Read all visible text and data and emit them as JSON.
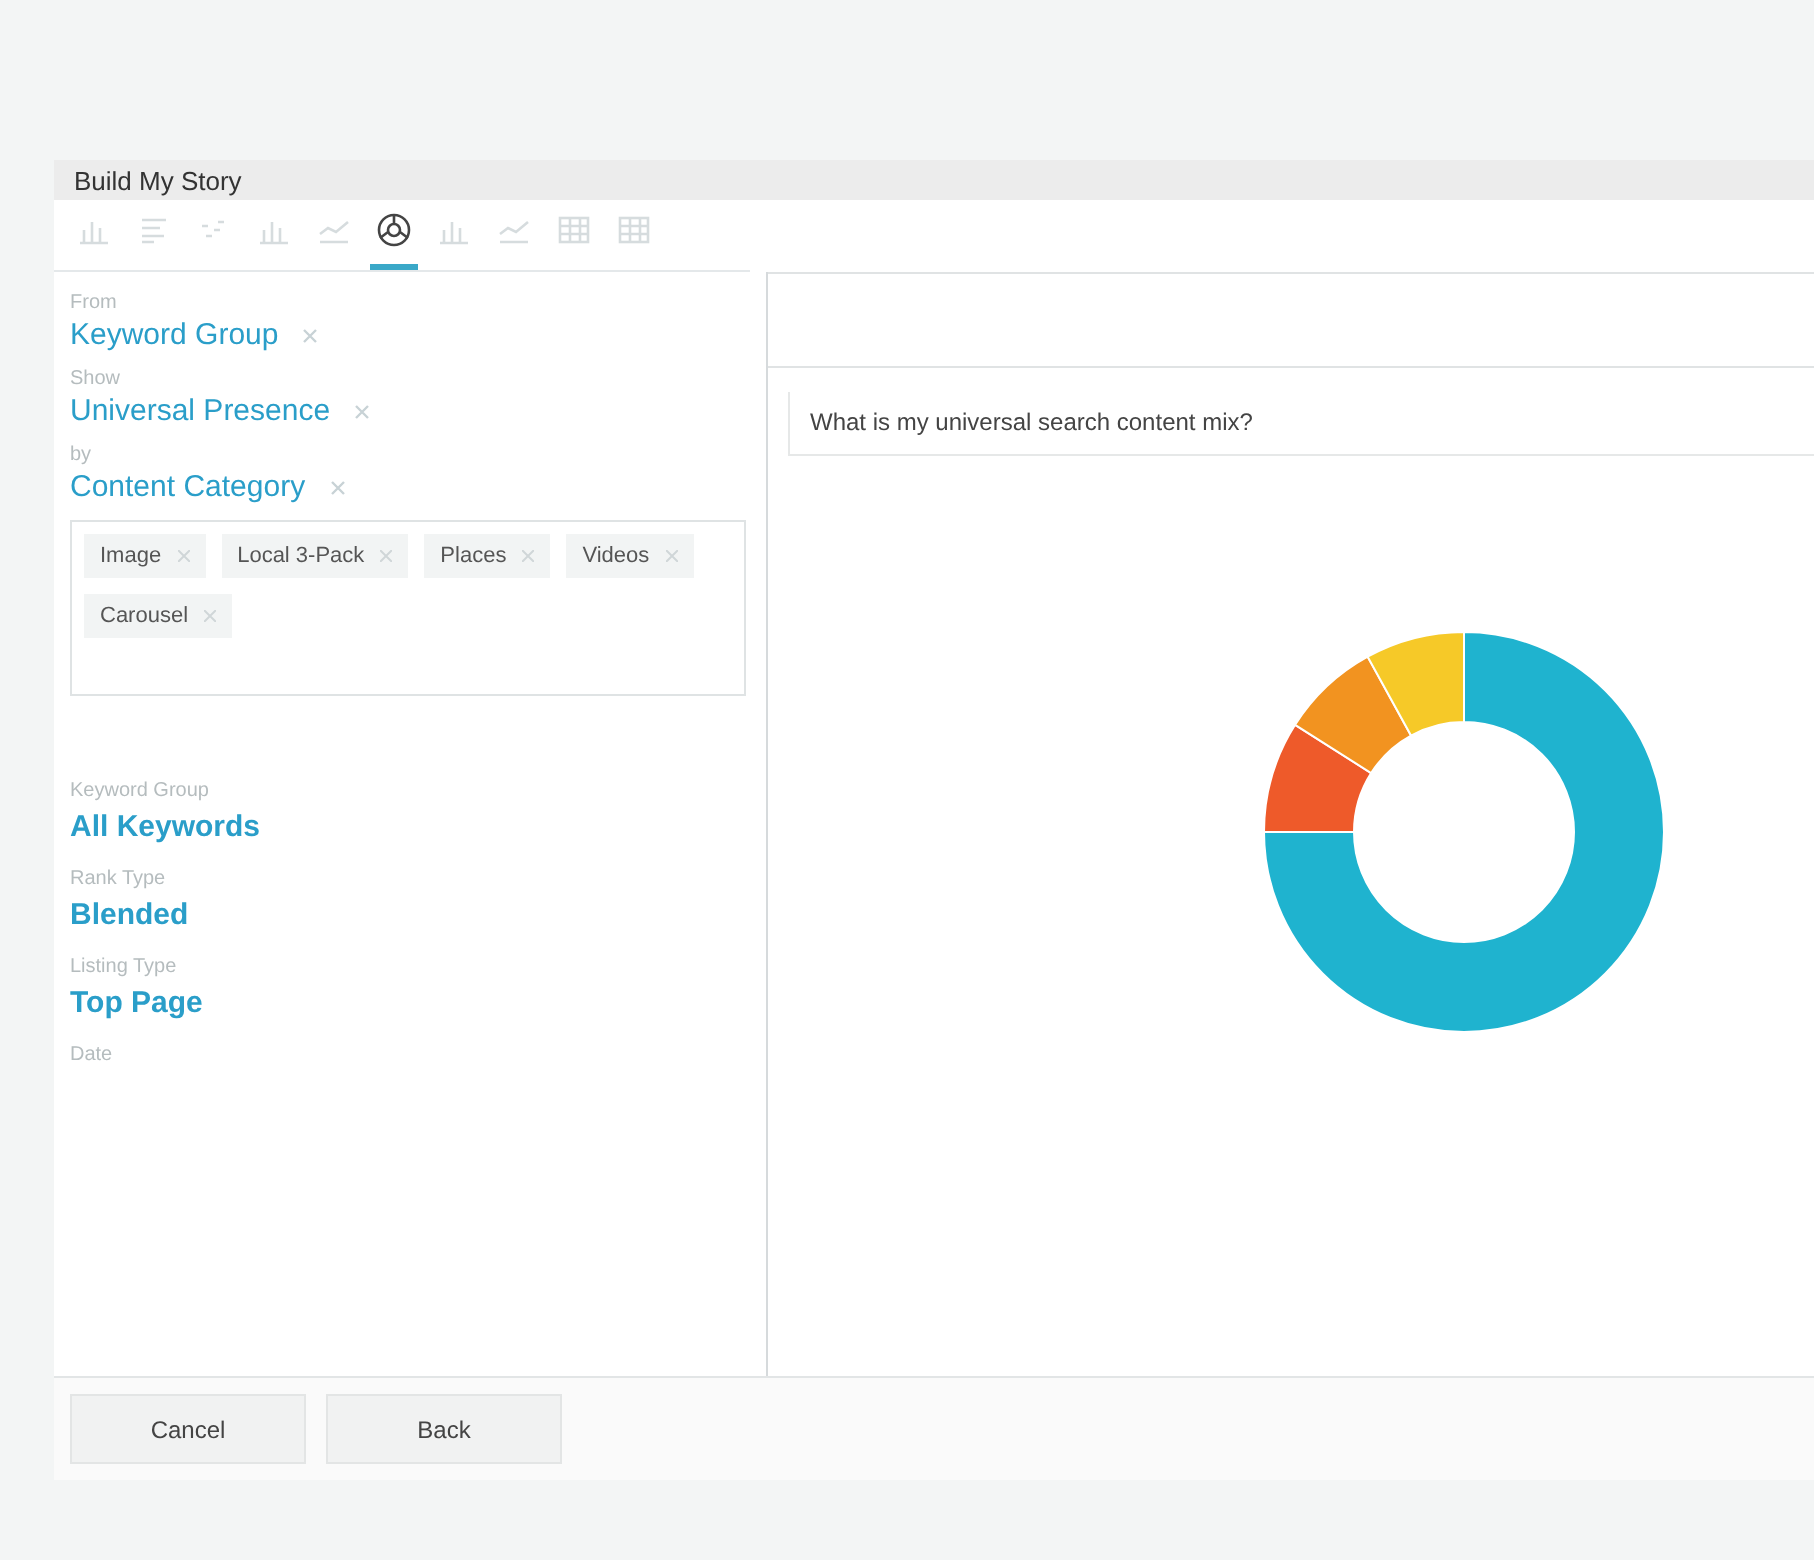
{
  "window": {
    "title": "Build My Story"
  },
  "chart_types": [
    {
      "kind": "bar",
      "selected": false
    },
    {
      "kind": "list",
      "selected": false
    },
    {
      "kind": "scatter",
      "selected": false
    },
    {
      "kind": "column",
      "selected": false
    },
    {
      "kind": "line",
      "selected": false
    },
    {
      "kind": "donut",
      "selected": true
    },
    {
      "kind": "combo",
      "selected": false
    },
    {
      "kind": "area",
      "selected": false
    },
    {
      "kind": "table",
      "selected": false
    },
    {
      "kind": "grid",
      "selected": false
    }
  ],
  "builder": [
    {
      "label": "From",
      "value": "Keyword Group"
    },
    {
      "label": "Show",
      "value": "Universal Presence"
    },
    {
      "label": "by",
      "value": "Content Category"
    }
  ],
  "tags": [
    "Image",
    "Local 3-Pack",
    "Places",
    "Videos",
    "Carousel"
  ],
  "filters": [
    {
      "label": "Keyword Group",
      "value": "All Keywords"
    },
    {
      "label": "Rank Type",
      "value": "Blended"
    },
    {
      "label": "Listing Type",
      "value": "Top Page"
    },
    {
      "label": "Date"
    }
  ],
  "question": "What is my universal search content mix?",
  "buttons": [
    "Cancel",
    "Back"
  ]
}
